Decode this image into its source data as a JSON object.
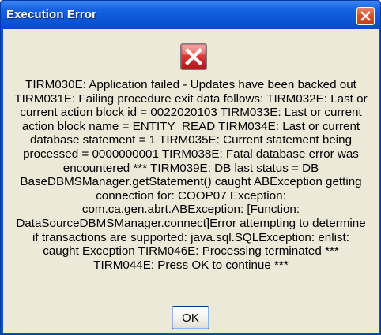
{
  "window": {
    "title": "Execution Error"
  },
  "icons": {
    "title_close": "close-icon",
    "message_icon": "error-icon"
  },
  "colors": {
    "titlebar": "#0a53d2",
    "close_button": "#d9542c",
    "client_background": "#ece9d8",
    "error_icon": "#d02828"
  },
  "message": {
    "lines": [
      "TIRM030E: Application failed - Updates have been backed out",
      "TIRM031E: Failing procedure exit data follows: TIRM032E: Last or",
      "current action block id = 0022020103 TIRM033E: Last or current",
      "action block name = ENTITY_READ TIRM034E: Last or current",
      "database statement = 1 TIRM035E: Current statement being",
      "processed = 0000000001 TIRM038E: Fatal database error was",
      "encountered *** TIRM039E: DB last status = DB",
      "BaseDBMSManager.getStatement() caught ABException getting",
      "connection for: COOP07 Exception:",
      "com.ca.gen.abrt.ABException: [Function:",
      "DataSourceDBMSManager.connect]Error attempting to determine",
      "if transactions are supported: java.sql.SQLException: enlist:",
      "caught Exception TIRM046E: Processing terminated ***",
      "TIRM044E: Press OK to continue ***"
    ]
  },
  "buttons": {
    "ok_label": "OK"
  }
}
